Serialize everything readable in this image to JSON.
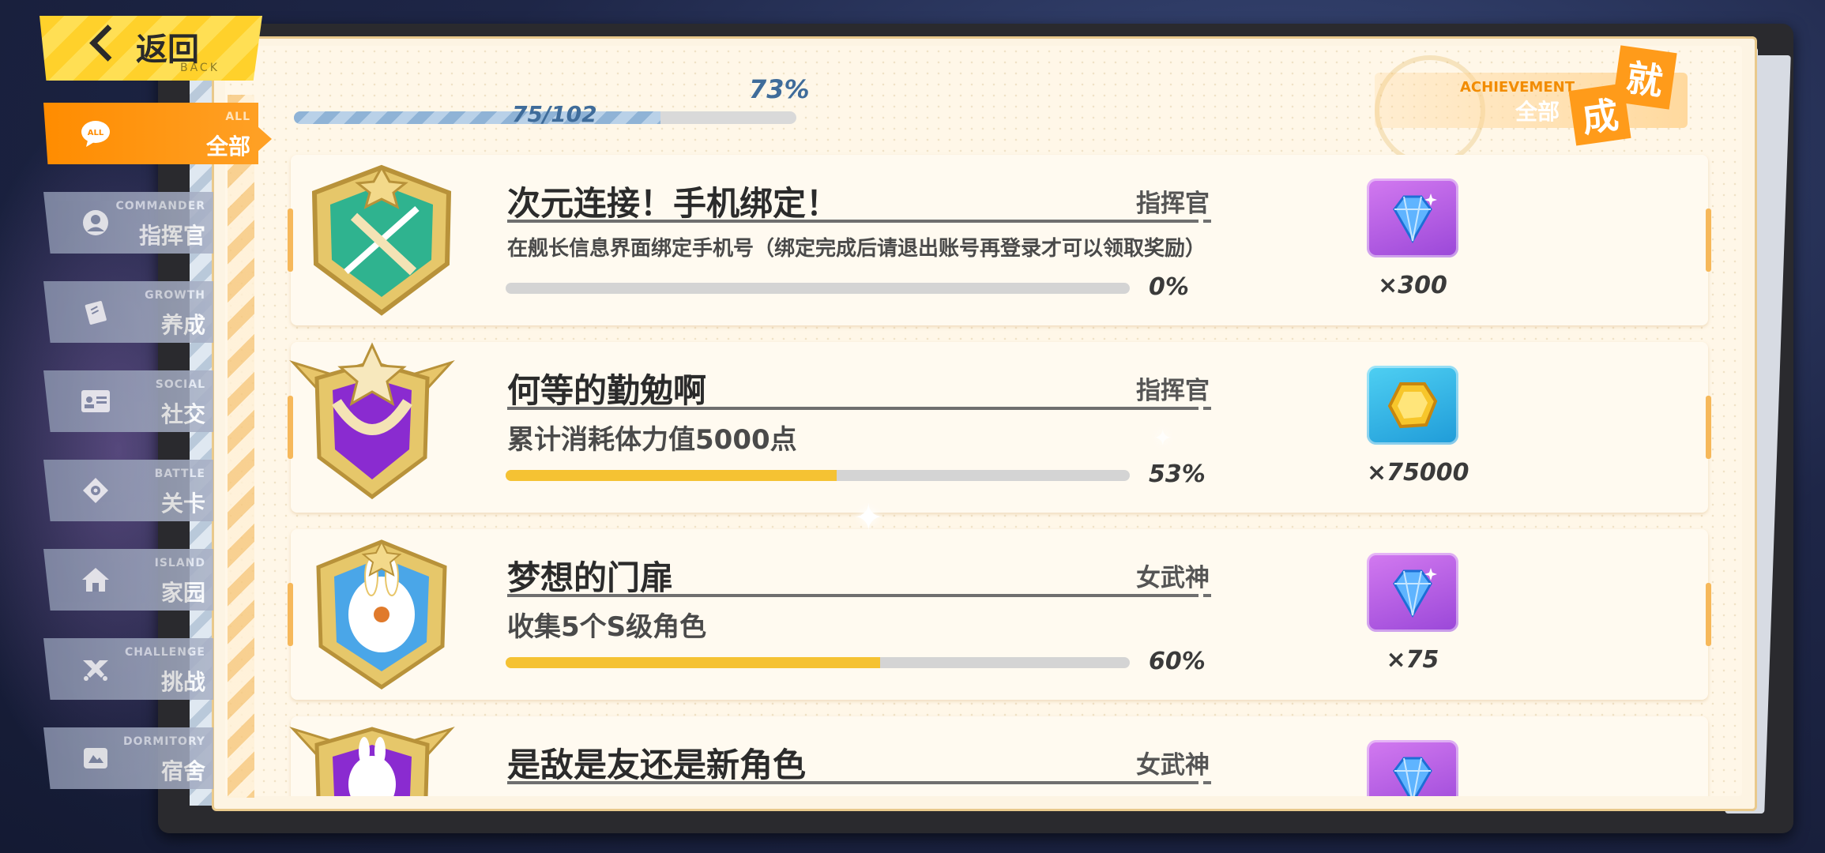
{
  "back": {
    "label": "返回",
    "sub": "BACK"
  },
  "nav": [
    {
      "en": "ALL",
      "zh": "全部",
      "icon": "chat-bubble-icon",
      "active": true
    },
    {
      "en": "COMMANDER",
      "zh": "指挥官",
      "icon": "user-icon"
    },
    {
      "en": "GROWTH",
      "zh": "养成",
      "icon": "book-icon"
    },
    {
      "en": "SOCIAL",
      "zh": "社交",
      "icon": "id-card-icon"
    },
    {
      "en": "BATTLE",
      "zh": "关卡",
      "icon": "target-icon"
    },
    {
      "en": "ISLAND",
      "zh": "家园",
      "icon": "home-icon"
    },
    {
      "en": "CHALLENGE",
      "zh": "挑战",
      "icon": "challenge-icon"
    },
    {
      "en": "DORMITORY",
      "zh": "宿舍",
      "icon": "dormitory-icon"
    }
  ],
  "progress": {
    "count": "75/102",
    "percent": "73%",
    "fraction": 0.73
  },
  "achievement_header": {
    "en": "ACHIEVEMENT",
    "zh": "全部",
    "char1": "成",
    "char2": "就"
  },
  "achievements": [
    {
      "title": "次元连接！手机绑定！",
      "category": "指挥官",
      "desc": "在舰长信息界面绑定手机号（绑定完成后请退出账号再登录才可以领取奖励）",
      "percent": "0%",
      "fraction": 0.0,
      "reward_icon": "blue-crystal-icon",
      "reward_bg": "purple",
      "reward_qty": "×300"
    },
    {
      "title": "何等的勤勉啊",
      "category": "指挥官",
      "desc": "累计消耗体力值5000点",
      "percent": "53%",
      "fraction": 0.53,
      "reward_icon": "gold-coin-icon",
      "reward_bg": "blue",
      "reward_qty": "×75000"
    },
    {
      "title": "梦想的门扉",
      "category": "女武神",
      "desc": "收集5个S级角色",
      "percent": "60%",
      "fraction": 0.6,
      "reward_icon": "blue-crystal-icon",
      "reward_bg": "purple",
      "reward_qty": "×75"
    },
    {
      "title": "是敌是友还是新角色",
      "category": "女武神",
      "desc": "",
      "percent": "",
      "fraction": 0,
      "reward_icon": "blue-crystal-icon",
      "reward_bg": "purple",
      "reward_qty": ""
    }
  ],
  "colors": {
    "accent": "#ff9b1a",
    "progress_fill": "#f5c233",
    "total_fill": "#8fb3d6"
  }
}
